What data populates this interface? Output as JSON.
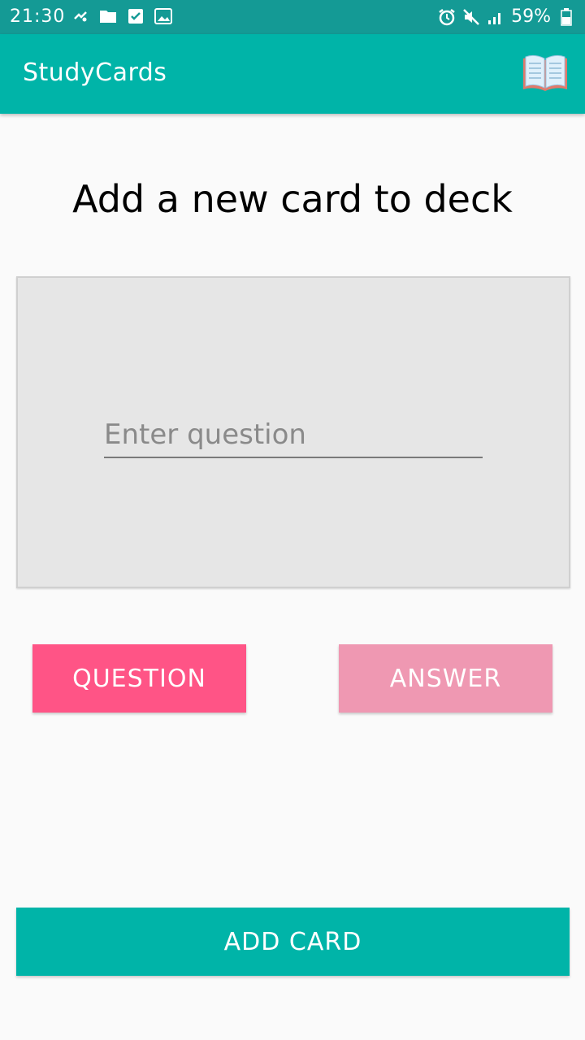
{
  "status_bar": {
    "time": "21:30",
    "battery": "59%",
    "left_icons": [
      "accessibility-icon",
      "folder-icon",
      "checkbox-icon",
      "image-icon"
    ],
    "right_icons": [
      "alarm-icon",
      "mute-icon",
      "signal-icon",
      "battery-icon"
    ]
  },
  "app_bar": {
    "title": "StudyCards",
    "icon": "book-icon"
  },
  "main": {
    "heading": "Add a new card to deck",
    "question_placeholder": "Enter question",
    "question_value": ""
  },
  "buttons": {
    "question": "QUESTION",
    "answer": "ANSWER",
    "add_card": "ADD CARD"
  },
  "colors": {
    "status_bar": "#149a95",
    "app_bar": "#00b4a8",
    "question_active": "#ff5486",
    "answer_inactive": "#ef98b2",
    "add_card": "#00b4a8"
  }
}
